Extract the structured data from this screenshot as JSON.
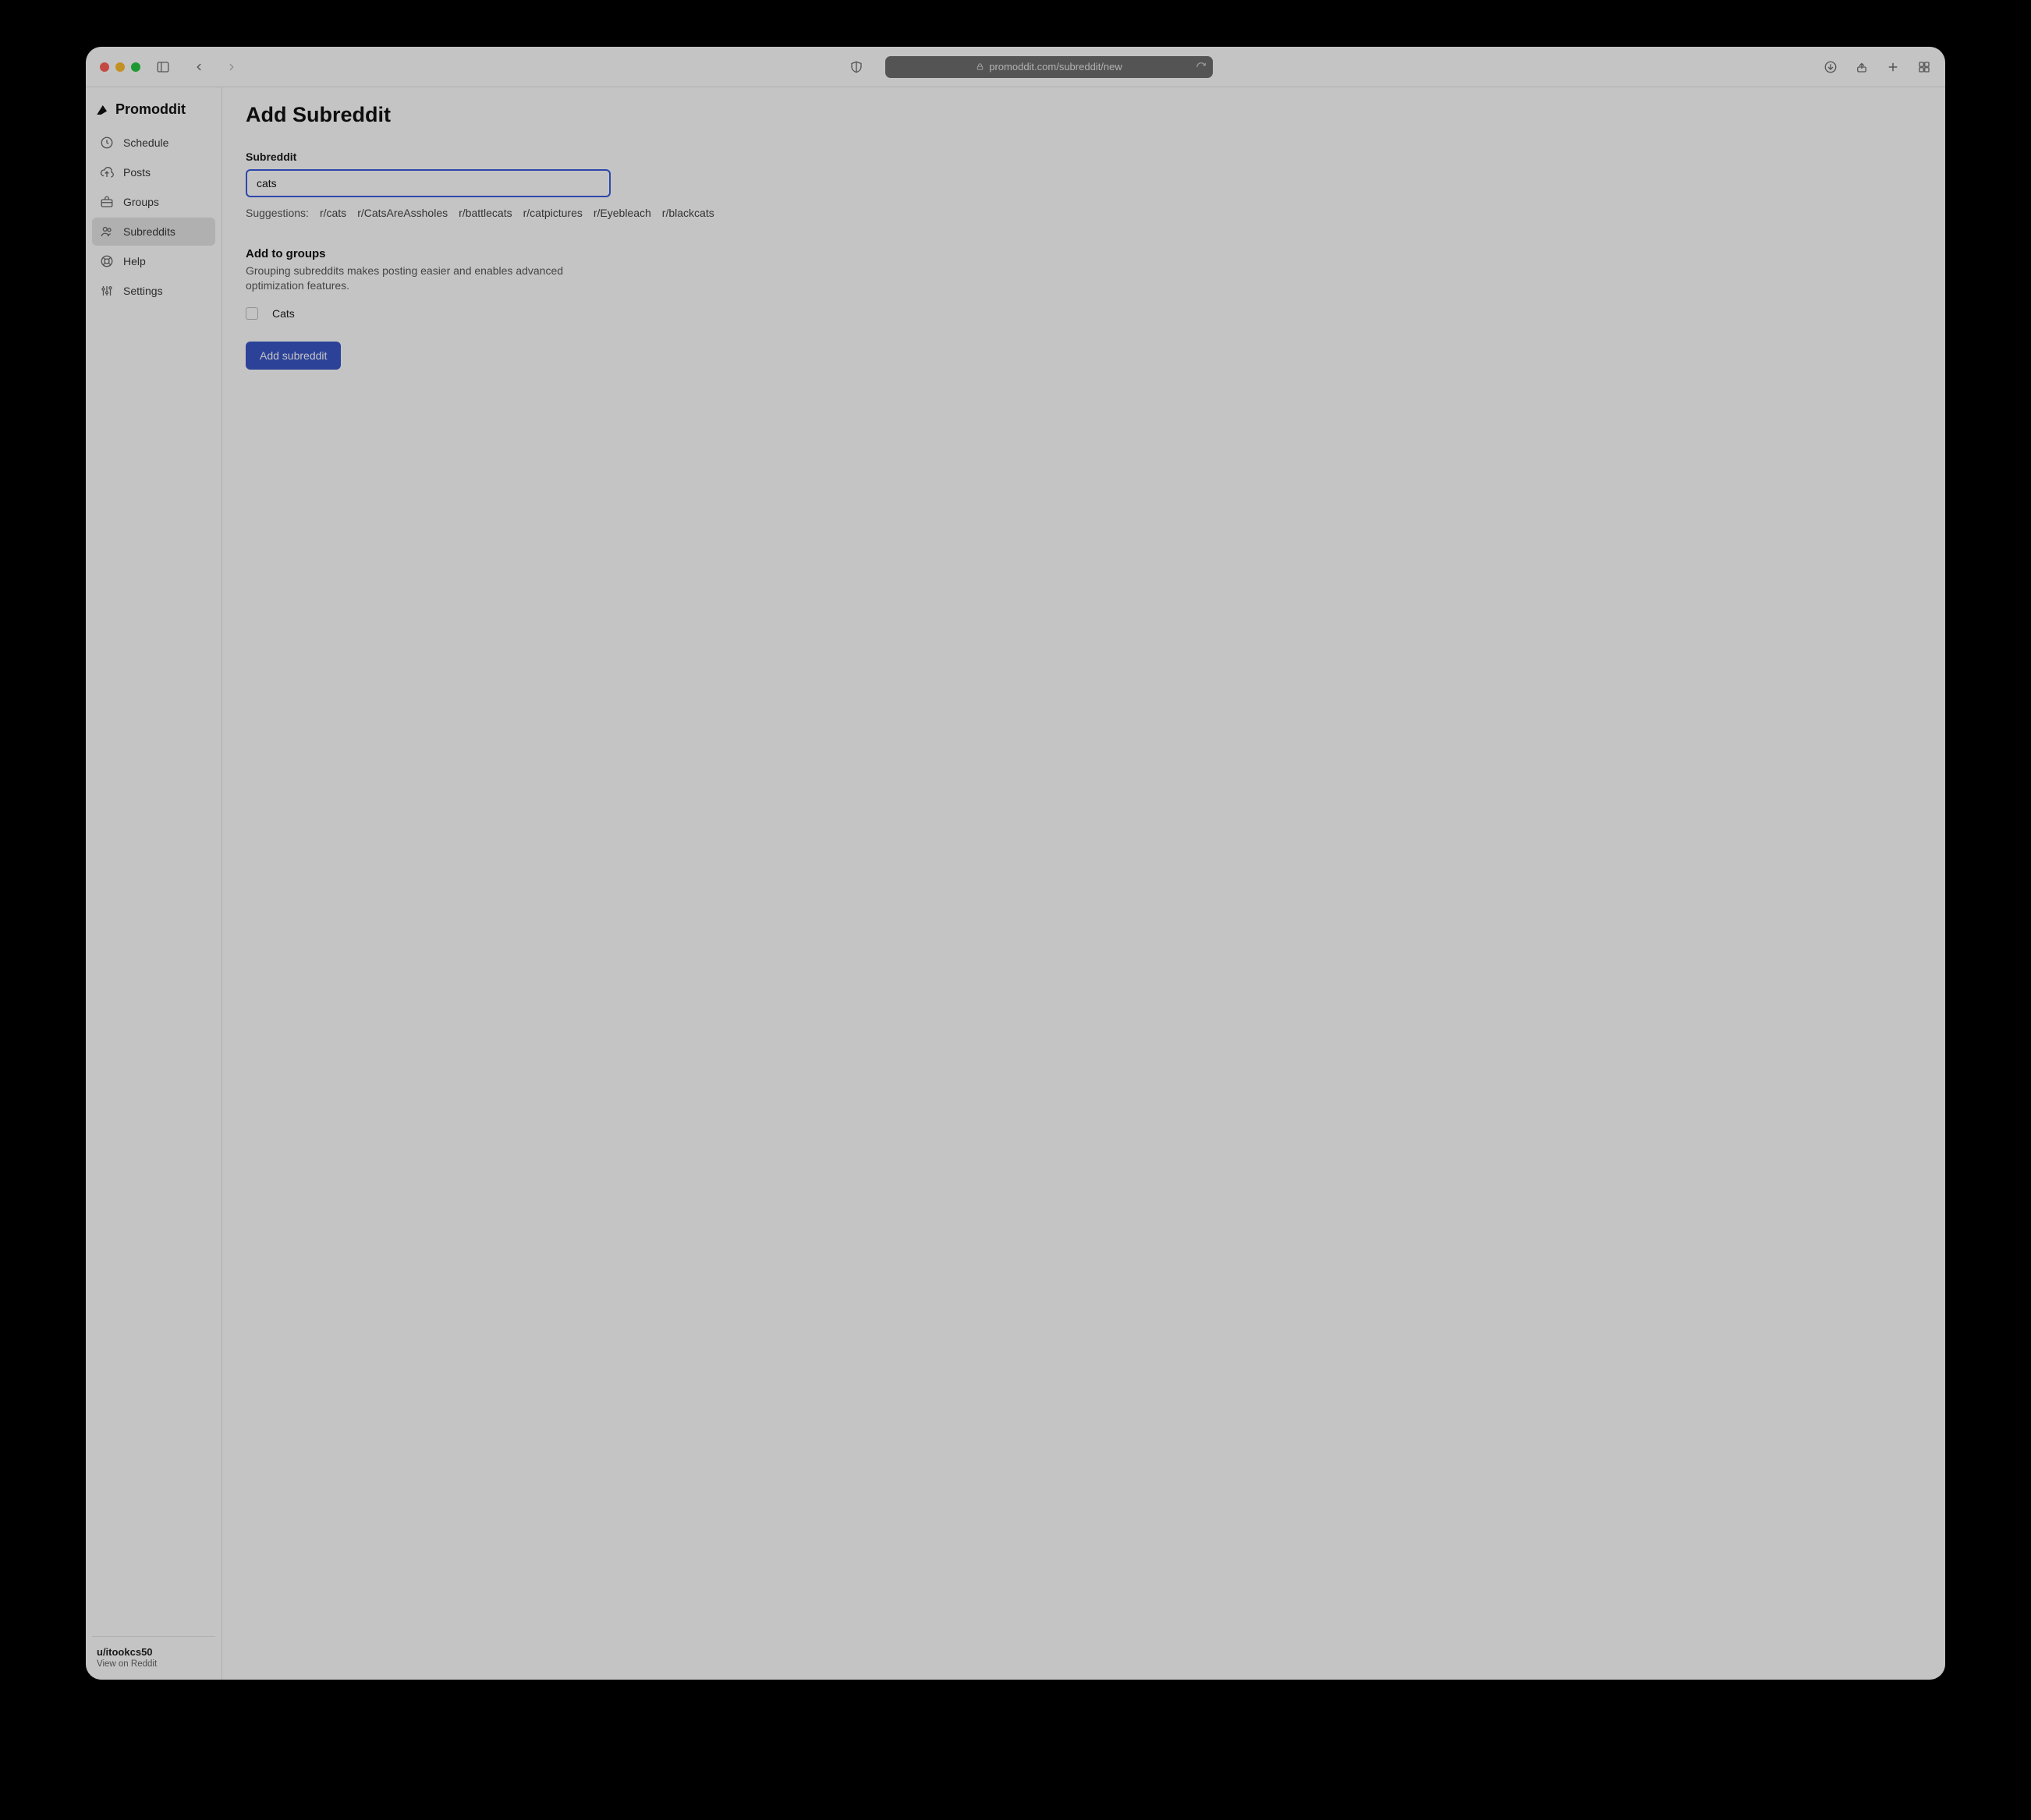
{
  "browser": {
    "url": "promoddit.com/subreddit/new"
  },
  "brand": {
    "name": "Promoddit"
  },
  "sidebar": {
    "items": [
      {
        "label": "Schedule",
        "icon": "clock-icon",
        "active": false
      },
      {
        "label": "Posts",
        "icon": "upload-cloud-icon",
        "active": false
      },
      {
        "label": "Groups",
        "icon": "briefcase-icon",
        "active": false
      },
      {
        "label": "Subreddits",
        "icon": "users-icon",
        "active": true
      },
      {
        "label": "Help",
        "icon": "life-ring-icon",
        "active": false
      },
      {
        "label": "Settings",
        "icon": "sliders-icon",
        "active": false
      }
    ],
    "footer": {
      "username": "u/itookcs50",
      "link_label": "View on Reddit"
    }
  },
  "page": {
    "title": "Add Subreddit",
    "subreddit_field": {
      "label": "Subreddit",
      "value": "cats"
    },
    "suggestions": {
      "label": "Suggestions:",
      "items": [
        "r/cats",
        "r/CatsAreAssholes",
        "r/battlecats",
        "r/catpictures",
        "r/Eyebleach",
        "r/blackcats"
      ]
    },
    "groups_section": {
      "title": "Add to groups",
      "description": "Grouping subreddits makes posting easier and enables advanced optimization features.",
      "options": [
        {
          "label": "Cats",
          "checked": false
        }
      ]
    },
    "submit_label": "Add subreddit"
  }
}
